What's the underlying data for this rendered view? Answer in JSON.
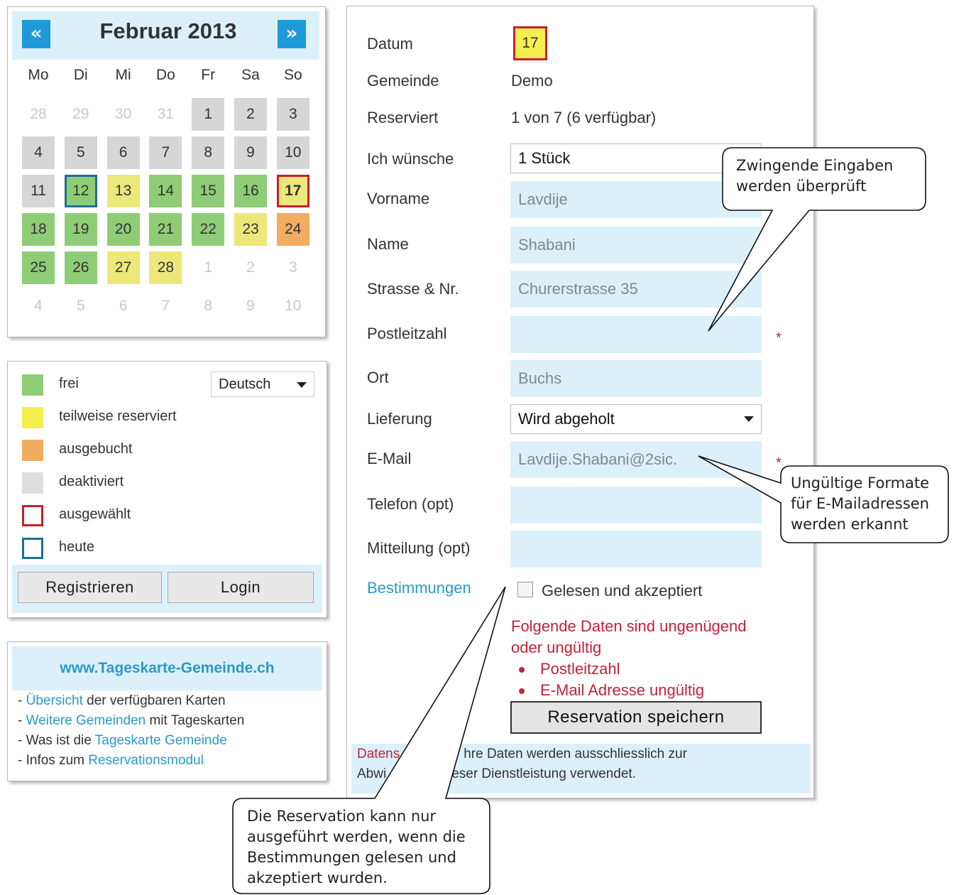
{
  "calendar": {
    "title": "Februar 2013",
    "prev": "«",
    "next": "»",
    "weekdays": [
      "Mo",
      "Di",
      "Mi",
      "Do",
      "Fr",
      "Sa",
      "So"
    ],
    "weeks": [
      [
        {
          "n": "28",
          "s": "out"
        },
        {
          "n": "29",
          "s": "out"
        },
        {
          "n": "30",
          "s": "out"
        },
        {
          "n": "31",
          "s": "out"
        },
        {
          "n": "1",
          "s": "d"
        },
        {
          "n": "2",
          "s": "d"
        },
        {
          "n": "3",
          "s": "d"
        }
      ],
      [
        {
          "n": "4",
          "s": "d"
        },
        {
          "n": "5",
          "s": "d"
        },
        {
          "n": "6",
          "s": "d"
        },
        {
          "n": "7",
          "s": "d"
        },
        {
          "n": "8",
          "s": "d"
        },
        {
          "n": "9",
          "s": "d"
        },
        {
          "n": "10",
          "s": "d"
        }
      ],
      [
        {
          "n": "11",
          "s": "d"
        },
        {
          "n": "12",
          "s": "g today"
        },
        {
          "n": "13",
          "s": "y"
        },
        {
          "n": "14",
          "s": "g"
        },
        {
          "n": "15",
          "s": "g"
        },
        {
          "n": "16",
          "s": "g"
        },
        {
          "n": "17",
          "s": "y sel"
        }
      ],
      [
        {
          "n": "18",
          "s": "g"
        },
        {
          "n": "19",
          "s": "g"
        },
        {
          "n": "20",
          "s": "g"
        },
        {
          "n": "21",
          "s": "g"
        },
        {
          "n": "22",
          "s": "g"
        },
        {
          "n": "23",
          "s": "y"
        },
        {
          "n": "24",
          "s": "o"
        }
      ],
      [
        {
          "n": "25",
          "s": "g"
        },
        {
          "n": "26",
          "s": "g"
        },
        {
          "n": "27",
          "s": "y"
        },
        {
          "n": "28",
          "s": "y"
        },
        {
          "n": "1",
          "s": "out"
        },
        {
          "n": "2",
          "s": "out"
        },
        {
          "n": "3",
          "s": "out"
        }
      ],
      [
        {
          "n": "4",
          "s": "out"
        },
        {
          "n": "5",
          "s": "out"
        },
        {
          "n": "6",
          "s": "out"
        },
        {
          "n": "7",
          "s": "out"
        },
        {
          "n": "8",
          "s": "out"
        },
        {
          "n": "9",
          "s": "out"
        },
        {
          "n": "10",
          "s": "out"
        }
      ]
    ]
  },
  "legend": {
    "items": [
      {
        "label": "frei",
        "color": "#8fcc76",
        "outline": ""
      },
      {
        "label": "teilweise reserviert",
        "color": "#f5ee50",
        "outline": ""
      },
      {
        "label": "ausgebucht",
        "color": "#f0ad62",
        "outline": ""
      },
      {
        "label": "deaktiviert",
        "color": "#dedede",
        "outline": ""
      },
      {
        "label": "ausgewählt",
        "color": "#ffffff",
        "outline": "#c91e2e"
      },
      {
        "label": "heute",
        "color": "#ffffff",
        "outline": "#1e6f96"
      }
    ],
    "language": "Deutsch",
    "register": "Registrieren",
    "login": "Login"
  },
  "links": {
    "title": "www.Tageskarte-Gemeinde.ch",
    "rows": [
      {
        "pre": "- ",
        "link": "Übersicht",
        "post": " der verfügbaren Karten"
      },
      {
        "pre": "- ",
        "link": "Weitere Gemeinden",
        "post": " mit Tageskarten"
      },
      {
        "pre": "- Was ist die ",
        "link": "Tageskarte Gemeinde",
        "post": ""
      },
      {
        "pre": "- Infos zum ",
        "link": "Reservationsmodul",
        "post": ""
      }
    ]
  },
  "form": {
    "labels": {
      "datum": "Datum",
      "gemeinde": "Gemeinde",
      "reserviert": "Reserviert",
      "wunsch": "Ich wünsche",
      "vorname": "Vorname",
      "name": "Name",
      "strasse": "Strasse & Nr.",
      "plz": "Postleitzahl",
      "ort": "Ort",
      "lieferung": "Lieferung",
      "email": "E-Mail",
      "telefon": "Telefon (opt)",
      "mitteilung": "Mitteilung (opt)"
    },
    "values": {
      "datum": "17",
      "gemeinde": "Demo",
      "reserviert": "1 von 7 (6 verfügbar)",
      "wunsch": "1 Stück",
      "vorname": "Lavdije",
      "name": "Shabani",
      "strasse": "Churerstrasse 35",
      "plz": "",
      "ort": "Buchs",
      "lieferung": "Wird abgeholt",
      "email": "Lavdije.Shabani@2sic.",
      "telefon": "",
      "mitteilung": ""
    },
    "required_mark": "*",
    "terms_link": "Bestimmungen",
    "terms_label": "Gelesen und akzeptiert",
    "error_title_1": "Folgende Daten sind ungenügend",
    "error_title_2": "oder ungültig",
    "errors": [
      "Postleitzahl",
      "E-Mail Adresse ungültig"
    ],
    "save": "Reservation speichern",
    "privacy_1_key": "Datens",
    "privacy_1_rest": "hre Daten werden ausschliesslich zur",
    "privacy_2_a": "Abwi",
    "privacy_2_b": "eser Dienstleistung verwendet."
  },
  "callouts": {
    "c1": [
      "Zwingende Eingaben",
      "werden überprüft"
    ],
    "c2": [
      "Ungültige Formate",
      "für E-Mailadressen",
      "werden erkannt"
    ],
    "c3": [
      "Die Reservation kann nur",
      "ausgeführt werden, wenn die",
      "Bestimmungen gelesen und",
      "akzeptiert wurden."
    ]
  }
}
